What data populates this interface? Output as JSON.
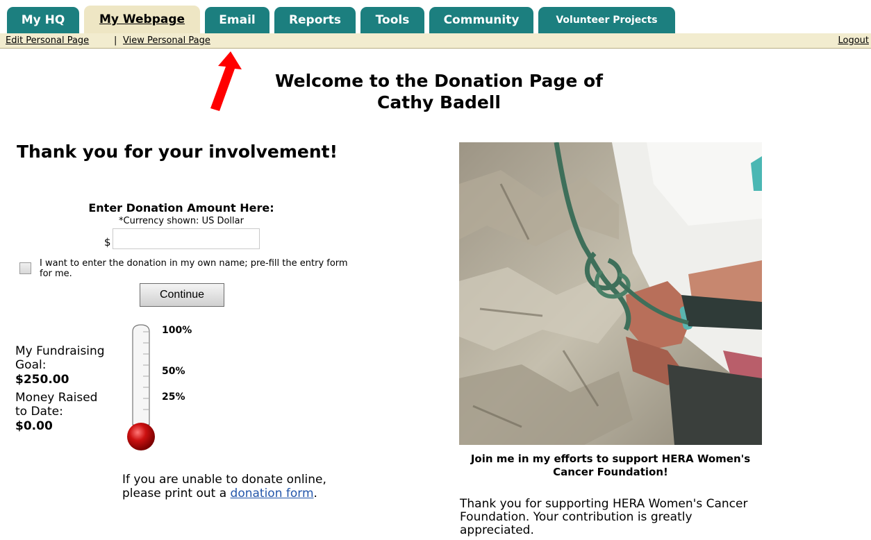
{
  "tabs": [
    {
      "label": "My HQ"
    },
    {
      "label": "My Webpage"
    },
    {
      "label": "Email"
    },
    {
      "label": "Reports"
    },
    {
      "label": "Tools"
    },
    {
      "label": "Community"
    },
    {
      "label": "Volunteer Projects"
    }
  ],
  "subnav": {
    "edit_link": "Edit Personal Page",
    "separator": "|",
    "view_link": "View Personal Page",
    "logout": "Logout"
  },
  "welcome": {
    "line1": "Welcome to the Donation Page of",
    "line2": "Cathy Badell"
  },
  "thanks_heading": "Thank you for your involvement!",
  "donation": {
    "heading": "Enter Donation Amount Here:",
    "currency_note": "*Currency shown: US Dollar",
    "currency_symbol": "$",
    "amount_value": "",
    "prefill_label": "I want to enter the donation in my own name; pre-fill the entry form for me.",
    "continue_label": "Continue"
  },
  "goal": {
    "goal_label": "My Fundraising Goal:",
    "goal_value": "$250.00",
    "raised_label": "Money Raised to Date:",
    "raised_value": "$0.00",
    "fill_fraction": 0
  },
  "thermometer_labels": [
    "100%",
    "50%",
    "25%"
  ],
  "print_note": {
    "text": "If you are unable to donate online, please print out a",
    "link": "donation form",
    "end": "."
  },
  "photo_caption": "Join me in my efforts to support HERA Women's Cancer Foundation!",
  "support_text": "Thank you for supporting HERA Women's Cancer Foundation. Your contribution is greatly appreciated.",
  "colors": {
    "tab_teal": "#1c7f7f",
    "tab_active": "#eee6c4",
    "arrow_red": "#ff0000",
    "bulb_red": "#cc1111"
  }
}
